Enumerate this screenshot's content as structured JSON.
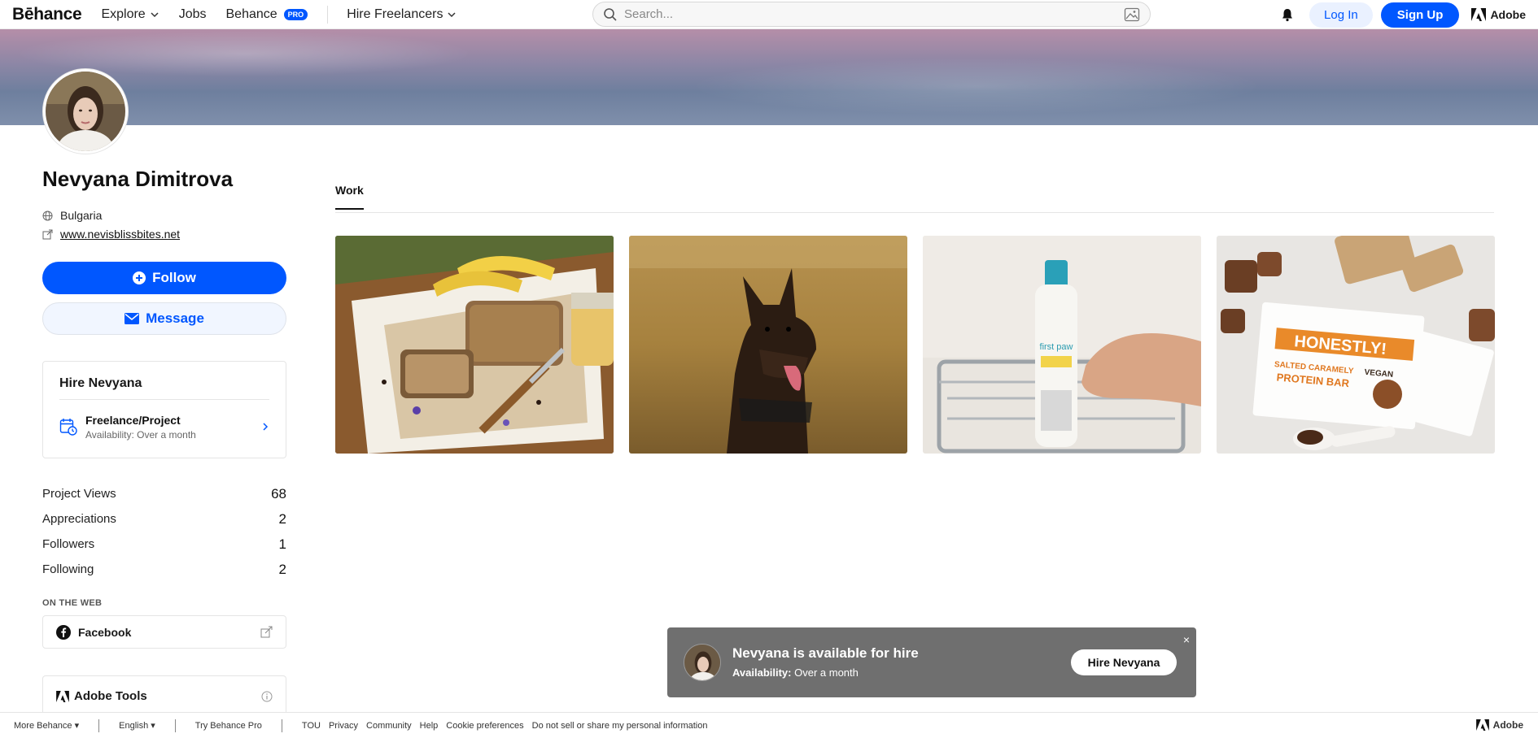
{
  "nav": {
    "logo": "Bēhance",
    "explore": "Explore",
    "jobs": "Jobs",
    "behance": "Behance",
    "pro_badge": "PRO",
    "hire_freelancers": "Hire Freelancers",
    "search_placeholder": "Search...",
    "login": "Log In",
    "signup": "Sign Up",
    "adobe": "Adobe"
  },
  "profile": {
    "name": "Nevyana Dimitrova",
    "location": "Bulgaria",
    "website": "www.nevisblissbites.net",
    "follow": "Follow",
    "message": "Message"
  },
  "hire": {
    "title": "Hire Nevyana",
    "item_title": "Freelance/Project",
    "item_sub": "Availability: Over a month"
  },
  "stats": [
    {
      "label": "Project Views",
      "value": "68"
    },
    {
      "label": "Appreciations",
      "value": "2"
    },
    {
      "label": "Followers",
      "value": "1"
    },
    {
      "label": "Following",
      "value": "2"
    }
  ],
  "web": {
    "heading": "ON THE WEB",
    "facebook": "Facebook"
  },
  "tools": {
    "title": "Adobe Tools"
  },
  "tabs": {
    "work": "Work"
  },
  "projects": [
    {
      "name": "banana-bread"
    },
    {
      "name": "dog-in-field"
    },
    {
      "name": "first-paw-bottle",
      "brand_text": "first paw"
    },
    {
      "name": "honestly-protein-bar",
      "brand_text": "HONESTLY!",
      "line2": "SALTED CARAMELY",
      "line3": "PROTEIN BAR",
      "vegan": "VEGAN"
    }
  ],
  "toast": {
    "title": "Nevyana is available for hire",
    "availability_label": "Availability:",
    "availability_value": "Over a month",
    "button": "Hire Nevyana",
    "close": "×"
  },
  "footer": {
    "more": "More Behance ▾",
    "language": "English ▾",
    "try_pro": "Try Behance Pro",
    "links": [
      "TOU",
      "Privacy",
      "Community",
      "Help",
      "Cookie preferences",
      "Do not sell or share my personal information"
    ],
    "adobe": "Adobe"
  },
  "colors": {
    "accent": "#0057ff",
    "toast_bg": "#6f6f6f"
  }
}
